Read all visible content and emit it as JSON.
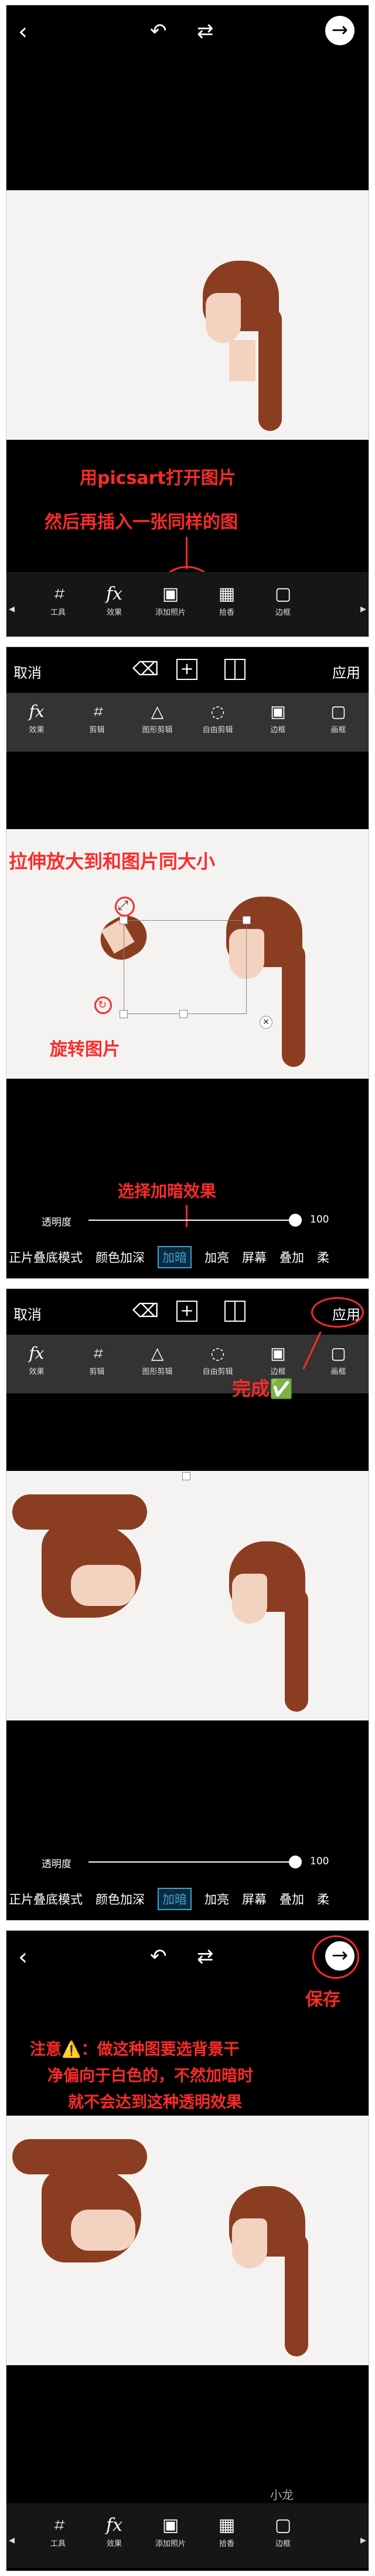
{
  "panel1": {
    "caption1": "用picsart打开图片",
    "caption2": "然后再插入一张同样的图",
    "tools": [
      {
        "icon": "crop-icon",
        "label": "工具"
      },
      {
        "icon": "fx-icon",
        "label": "效果"
      },
      {
        "icon": "add-photo-icon",
        "label": "添加照片"
      },
      {
        "icon": "frame-icon",
        "label": "拾香"
      },
      {
        "icon": "border-icon",
        "label": "边框"
      }
    ],
    "fx_glyph": "fx"
  },
  "panel2": {
    "cancel": "取消",
    "apply": "应用",
    "tools": [
      {
        "icon": "fx-icon",
        "label": "效果"
      },
      {
        "icon": "crop-icon",
        "label": "剪辑"
      },
      {
        "icon": "shape-crop-icon",
        "label": "图形剪辑"
      },
      {
        "icon": "free-crop-icon",
        "label": "自由剪辑"
      },
      {
        "icon": "border-icon",
        "label": "边框"
      },
      {
        "icon": "canvas-icon",
        "label": "画框"
      }
    ],
    "caption_stretch": "拉伸放大到和图片同大小",
    "caption_rotate": "旋转图片",
    "caption_blend": "选择加暗效果",
    "opacity_label": "透明度",
    "opacity_value": "100",
    "blends": [
      "正片叠底模式",
      "颜色加深",
      "加暗",
      "加亮",
      "屏幕",
      "叠加",
      "柔"
    ]
  },
  "panel3": {
    "cancel": "取消",
    "apply": "应用",
    "caption_done": "完成✅",
    "opacity_label": "透明度",
    "opacity_value": "100",
    "blends": [
      "正片叠底模式",
      "颜色加深",
      "加暗",
      "加亮",
      "屏幕",
      "叠加",
      "柔"
    ]
  },
  "panel4": {
    "caption_save": "保存",
    "note_line1": "注意⚠️：做这种图要选背景干",
    "note_line2": "净偏向于白色的，不然加暗时",
    "note_line3": "就不会达到这种透明效果",
    "watermark": "小龙",
    "tools": [
      {
        "icon": "crop-icon",
        "label": "工具"
      },
      {
        "icon": "fx-icon",
        "label": "效果"
      },
      {
        "icon": "add-photo-icon",
        "label": "添加照片"
      },
      {
        "icon": "frame-icon",
        "label": "拾香"
      },
      {
        "icon": "border-icon",
        "label": "边框"
      }
    ]
  },
  "colors": {
    "annotation_red": "#ff2a2a",
    "selected_blue": "#3aa0d8"
  }
}
